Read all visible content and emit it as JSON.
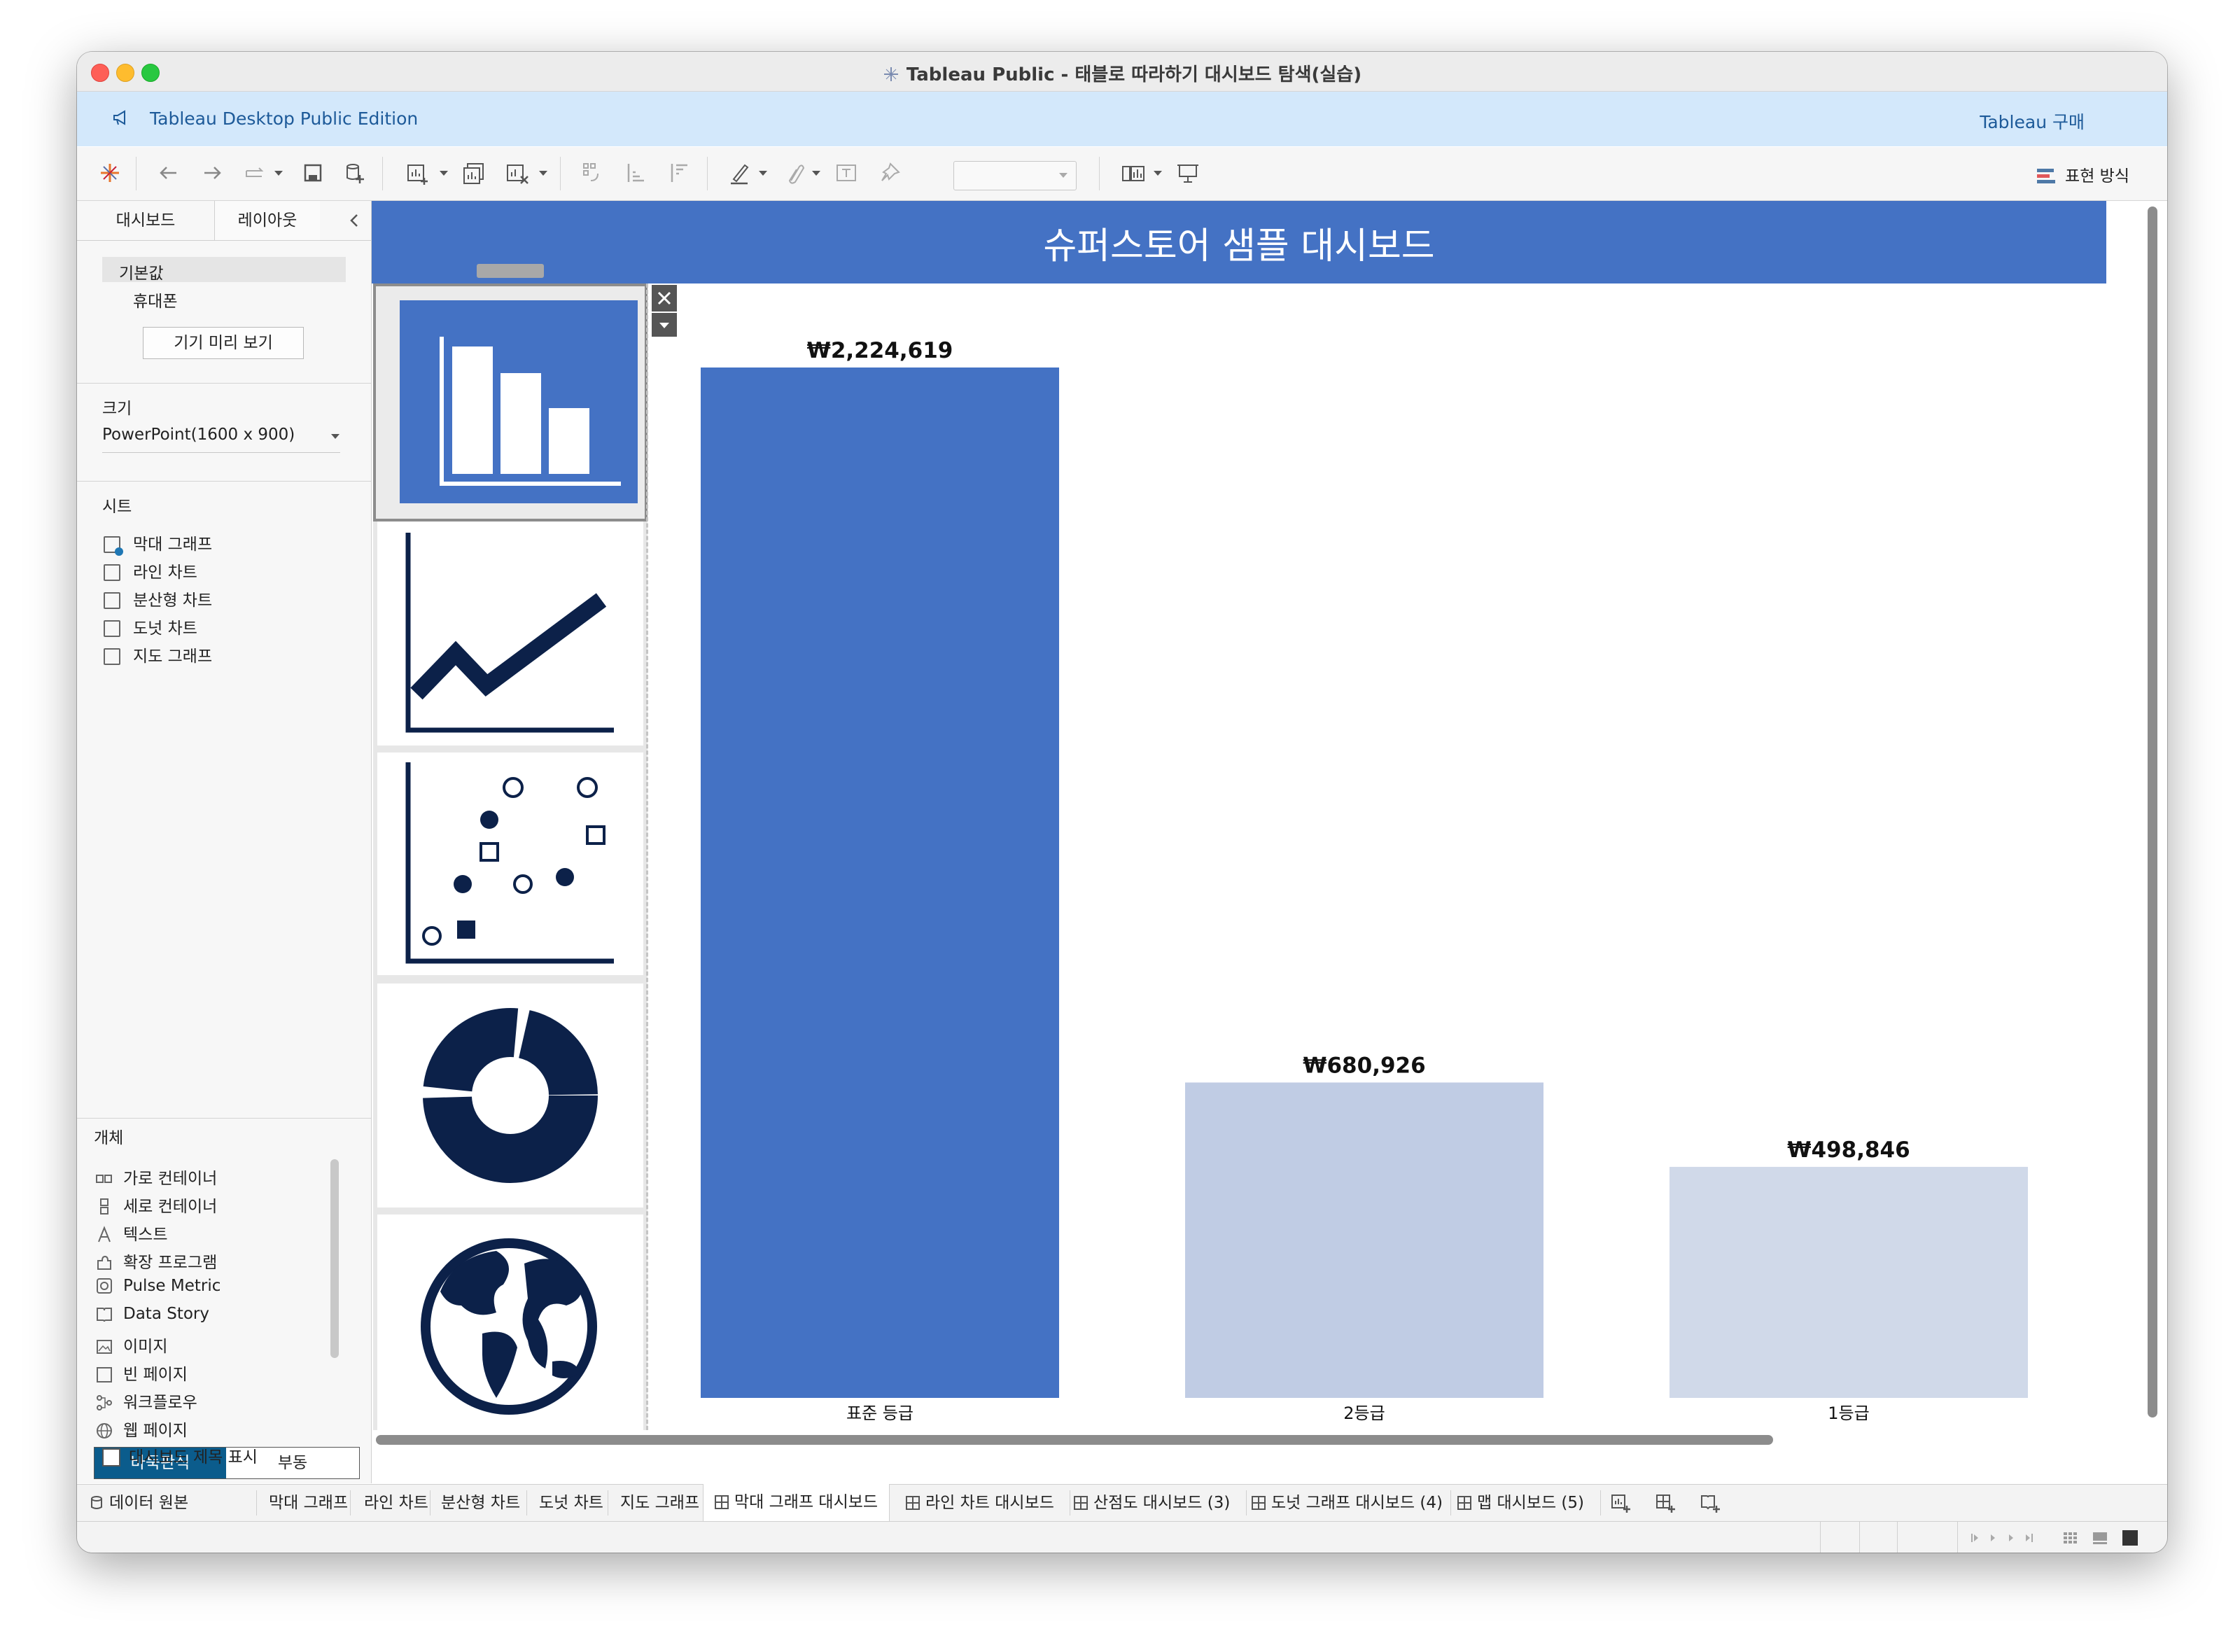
{
  "window": {
    "title": "Tableau Public - 태블로 따라하기 대시보드 탐색(실습)"
  },
  "banner": {
    "edition": "Tableau Desktop Public Edition",
    "buy": "Tableau 구매"
  },
  "toolbar": {
    "show_me": "표현 방식"
  },
  "left_panel": {
    "tabs": [
      "대시보드",
      "레이아웃"
    ],
    "device": {
      "default": "기본값",
      "phone": "휴대폰",
      "preview_button": "기기 미리 보기"
    },
    "size": {
      "label": "크기",
      "value": "PowerPoint(1600 x 900)"
    },
    "sheets": {
      "label": "시트",
      "items": [
        "막대 그래프",
        "라인 차트",
        "분산형 차트",
        "도넛 차트",
        "지도 그래프"
      ]
    },
    "objects": {
      "label": "개체",
      "items": [
        "가로 컨테이너",
        "세로 컨테이너",
        "텍스트",
        "확장 프로그램",
        "Pulse Metric",
        "Data Story",
        "이미지",
        "빈 페이지",
        "워크플로우",
        "웹 페이지"
      ]
    },
    "layout_mode": {
      "tiled": "바둑판식",
      "floating": "부동"
    },
    "show_title": "대시보드 제목 표시"
  },
  "dashboard": {
    "title": "슈퍼스토어 샘플 대시보드"
  },
  "chart_data": {
    "type": "bar",
    "categories": [
      "표준 등급",
      "2등급",
      "1등급"
    ],
    "values": [
      2224619,
      680926,
      498846
    ],
    "value_labels": [
      "₩2,224,619",
      "₩680,926",
      "₩498,846"
    ],
    "colors": [
      "#4472c4",
      "#c0cce4",
      "#d0d9e9"
    ],
    "ylim": [
      0,
      2224619
    ]
  },
  "sheet_tabs": {
    "data_source": "데이터 원본",
    "tabs": [
      "막대 그래프",
      "라인 차트",
      "분산형 차트",
      "도넛 차트",
      "지도 그래프",
      "막대 그래프 대시보드",
      "라인 차트 대시보드",
      "산점도 대시보드 (3)",
      "도넛 그래프 대시보드 (4)",
      "맵 대시보드 (5)"
    ]
  }
}
